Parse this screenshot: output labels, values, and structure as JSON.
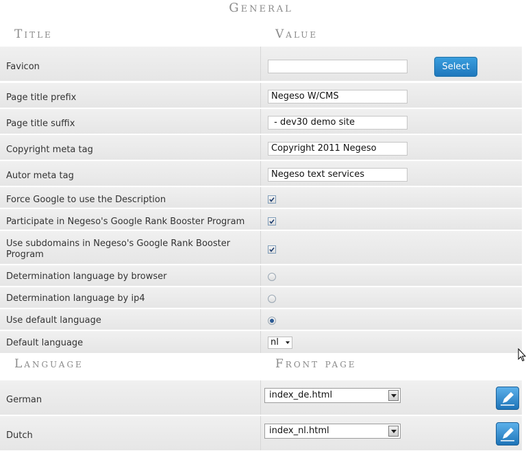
{
  "general": {
    "section_title": "General",
    "col_title": "Title",
    "col_value": "Value",
    "select_button": "Select",
    "rows": [
      {
        "label": "Favicon",
        "type": "file",
        "value": ""
      },
      {
        "label": "Page title prefix",
        "type": "text",
        "value": "Negeso W/CMS"
      },
      {
        "label": "Page title suffix",
        "type": "text",
        "value": " - dev30 demo site"
      },
      {
        "label": "Copyright meta tag",
        "type": "text",
        "value": "Copyright 2011 Negeso"
      },
      {
        "label": "Autor meta tag",
        "type": "text",
        "value": "Negeso text services"
      },
      {
        "label": "Force Google to use the Description",
        "type": "checkbox",
        "checked": true
      },
      {
        "label": "Participate in Negeso's Google Rank Booster Program",
        "type": "checkbox",
        "checked": true
      },
      {
        "label": "Use subdomains in Negeso's Google Rank Booster Program",
        "type": "checkbox",
        "checked": true
      },
      {
        "label": "Determination language by browser",
        "type": "radio",
        "checked": false
      },
      {
        "label": "Determination language by ip4",
        "type": "radio",
        "checked": false
      },
      {
        "label": "Use default language",
        "type": "radio",
        "checked": true
      },
      {
        "label": "Default language",
        "type": "select",
        "value": "nl"
      }
    ]
  },
  "language": {
    "col_language": "Language",
    "col_front_page": "Front page",
    "rows": [
      {
        "language": "German",
        "front_page": "index_de.html"
      },
      {
        "language": "Dutch",
        "front_page": "index_nl.html"
      }
    ]
  },
  "colors": {
    "accent": "#1f78bd",
    "row_bg": "#ececec",
    "header_text": "#8a8a8a"
  }
}
